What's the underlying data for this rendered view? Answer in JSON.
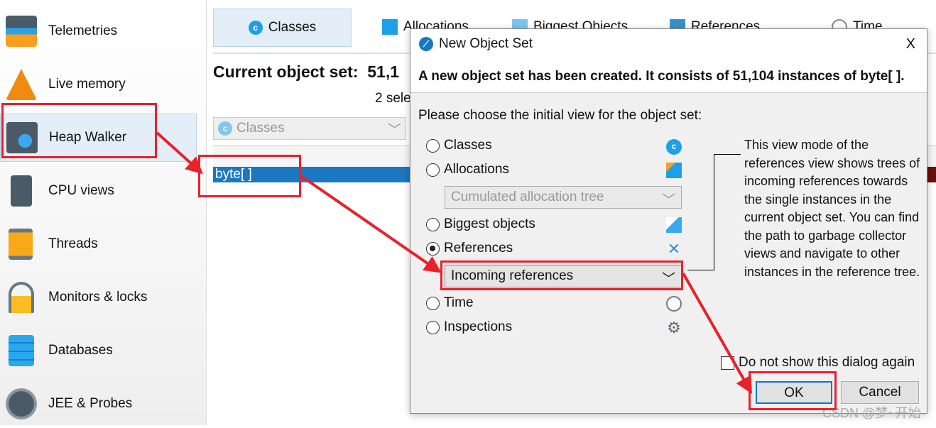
{
  "sidebar": {
    "items": [
      {
        "label": "Telemetries",
        "icon": "telemetries-icon"
      },
      {
        "label": "Live memory",
        "icon": "live-memory-icon"
      },
      {
        "label": "Heap Walker",
        "icon": "heap-walker-icon",
        "selected": true
      },
      {
        "label": "CPU views",
        "icon": "cpu-icon"
      },
      {
        "label": "Threads",
        "icon": "threads-icon"
      },
      {
        "label": "Monitors & locks",
        "icon": "lock-icon"
      },
      {
        "label": "Databases",
        "icon": "database-icon"
      },
      {
        "label": "JEE & Probes",
        "icon": "gauge-icon"
      }
    ]
  },
  "main": {
    "tabs": [
      {
        "label": "Classes",
        "active": true
      },
      {
        "label": "Allocations"
      },
      {
        "label": "Biggest Objects"
      },
      {
        "label": "References"
      },
      {
        "label": "Time"
      }
    ],
    "object_set_label": "Current object set:",
    "object_set_value": "51,1",
    "selected_text": "2 sele",
    "view_combo": "Classes",
    "row": "byte[ ]"
  },
  "dialog": {
    "title": "New Object Set",
    "close": "X",
    "header": "A new object set has been created. It consists of 51,104 instances of byte[ ].",
    "prompt": "Please choose the initial view for the object set:",
    "options": [
      {
        "label": "Classes"
      },
      {
        "label": "Allocations"
      },
      {
        "label": "Biggest objects"
      },
      {
        "label": "References",
        "selected": true
      },
      {
        "label": "Time"
      },
      {
        "label": "Inspections"
      }
    ],
    "allocation_combo": "Cumulated allocation tree",
    "references_combo": "Incoming references",
    "description": "This view mode of the references view shows trees of incoming references towards the single instances in the current object set. You can find the path to garbage collector views and navigate to other instances in the reference tree.",
    "checkbox": "Do not show this dialog again",
    "ok": "OK",
    "cancel": "Cancel"
  },
  "watermark": "CSDN @梦~开始",
  "colors": {
    "annotation": "#e8212b",
    "selection": "#1a78c2"
  }
}
